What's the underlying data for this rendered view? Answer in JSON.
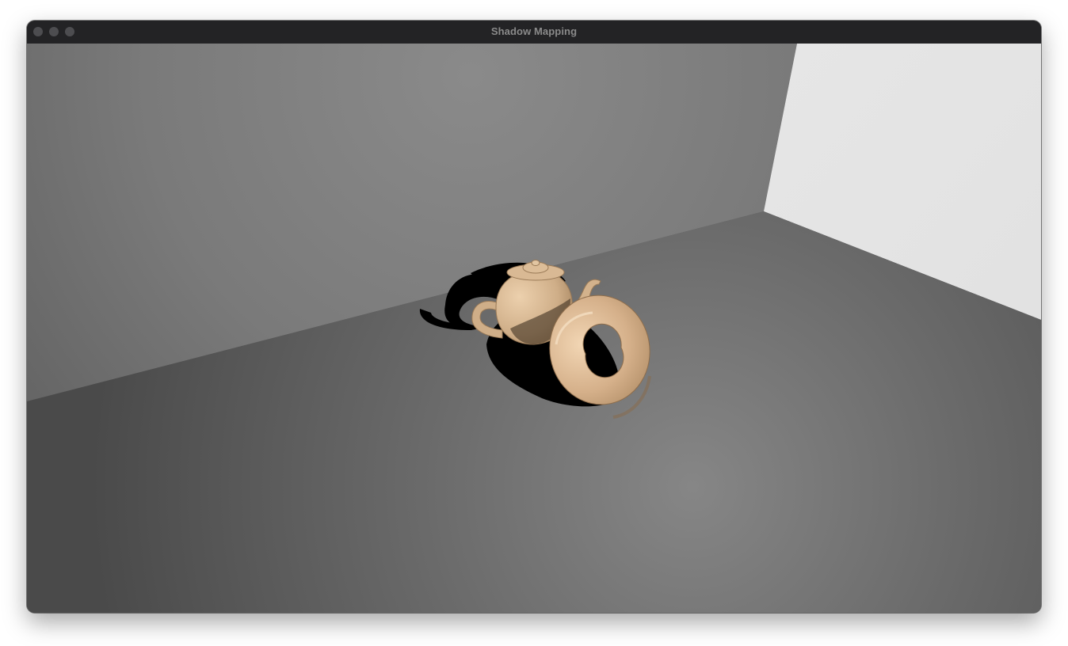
{
  "window": {
    "title": "Shadow Mapping"
  },
  "scene": {
    "objects": [
      "teapot",
      "torus"
    ],
    "object_color": "#d8b48c",
    "wall_color": "#7a7a7a",
    "floor_color": "#636363",
    "side_wall_color": "#e4e4e4",
    "shadow_color": "#000000"
  }
}
